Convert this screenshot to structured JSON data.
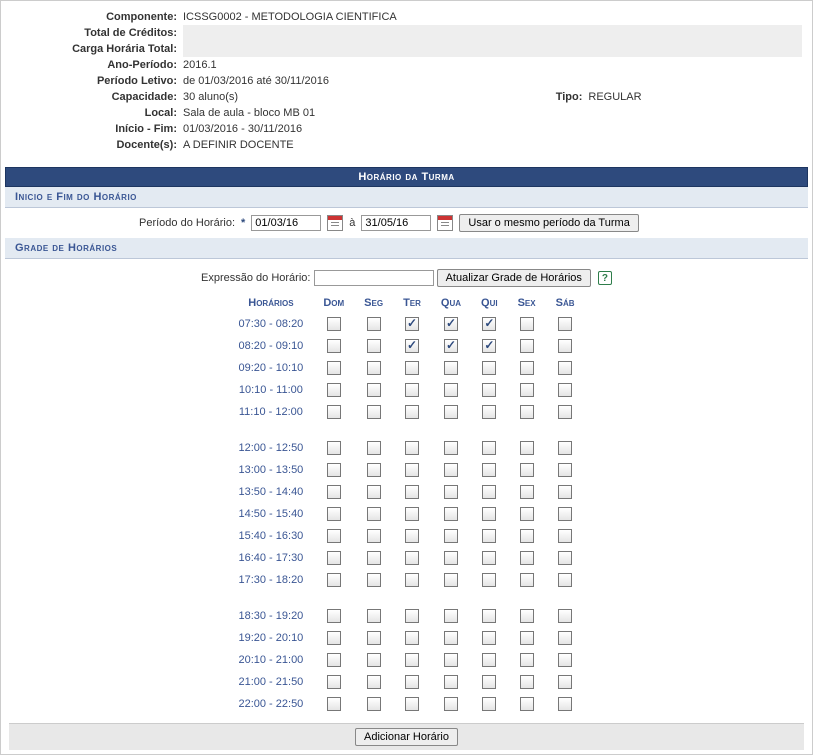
{
  "details": {
    "componente_label": "Componente:",
    "componente_value": "ICSSG0002 - METODOLOGIA CIENTIFICA",
    "creditos_label": "Total de Créditos:",
    "creditos_value": "",
    "carga_label": "Carga Horária Total:",
    "carga_value": "",
    "ano_label": "Ano-Período:",
    "ano_value": "2016.1",
    "periodo_label": "Período Letivo:",
    "periodo_value": "de 01/03/2016 até 30/11/2016",
    "capacidade_label": "Capacidade:",
    "capacidade_value": "30 aluno(s)",
    "tipo_label": "Tipo:",
    "tipo_value": "REGULAR",
    "local_label": "Local:",
    "local_value": "Sala de aula - bloco MB 01",
    "iniciofim_label": "Início - Fim:",
    "iniciofim_value": "01/03/2016 - 30/11/2016",
    "docentes_label": "Docente(s):",
    "docentes_value": "A DEFINIR DOCENTE"
  },
  "section_title": "Horário da Turma",
  "periodo_section": {
    "title": "Inicio e Fim do Horário",
    "label": "Período do Horário:",
    "start": "01/03/16",
    "sep": "à",
    "end": "31/05/16",
    "same_button": "Usar o mesmo período da Turma"
  },
  "grade_section": {
    "title": "Grade de Horários",
    "expr_label": "Expressão do Horário:",
    "expr_value": "",
    "update_button": "Atualizar Grade de Horários"
  },
  "schedule": {
    "header_time": "Horários",
    "days": [
      "Dom",
      "Seg",
      "Ter",
      "Qua",
      "Qui",
      "Sex",
      "Sáb"
    ],
    "blocks": [
      {
        "rows": [
          {
            "time": "07:30 - 08:20",
            "checks": [
              false,
              false,
              true,
              true,
              true,
              false,
              false
            ]
          },
          {
            "time": "08:20 - 09:10",
            "checks": [
              false,
              false,
              true,
              true,
              true,
              false,
              false
            ]
          },
          {
            "time": "09:20 - 10:10",
            "checks": [
              false,
              false,
              false,
              false,
              false,
              false,
              false
            ]
          },
          {
            "time": "10:10 - 11:00",
            "checks": [
              false,
              false,
              false,
              false,
              false,
              false,
              false
            ]
          },
          {
            "time": "11:10 - 12:00",
            "checks": [
              false,
              false,
              false,
              false,
              false,
              false,
              false
            ]
          }
        ]
      },
      {
        "rows": [
          {
            "time": "12:00 - 12:50",
            "checks": [
              false,
              false,
              false,
              false,
              false,
              false,
              false
            ]
          },
          {
            "time": "13:00 - 13:50",
            "checks": [
              false,
              false,
              false,
              false,
              false,
              false,
              false
            ]
          },
          {
            "time": "13:50 - 14:40",
            "checks": [
              false,
              false,
              false,
              false,
              false,
              false,
              false
            ]
          },
          {
            "time": "14:50 - 15:40",
            "checks": [
              false,
              false,
              false,
              false,
              false,
              false,
              false
            ]
          },
          {
            "time": "15:40 - 16:30",
            "checks": [
              false,
              false,
              false,
              false,
              false,
              false,
              false
            ]
          },
          {
            "time": "16:40 - 17:30",
            "checks": [
              false,
              false,
              false,
              false,
              false,
              false,
              false
            ]
          },
          {
            "time": "17:30 - 18:20",
            "checks": [
              false,
              false,
              false,
              false,
              false,
              false,
              false
            ]
          }
        ]
      },
      {
        "rows": [
          {
            "time": "18:30 - 19:20",
            "checks": [
              false,
              false,
              false,
              false,
              false,
              false,
              false
            ]
          },
          {
            "time": "19:20 - 20:10",
            "checks": [
              false,
              false,
              false,
              false,
              false,
              false,
              false
            ]
          },
          {
            "time": "20:10 - 21:00",
            "checks": [
              false,
              false,
              false,
              false,
              false,
              false,
              false
            ]
          },
          {
            "time": "21:00 - 21:50",
            "checks": [
              false,
              false,
              false,
              false,
              false,
              false,
              false
            ]
          },
          {
            "time": "22:00 - 22:50",
            "checks": [
              false,
              false,
              false,
              false,
              false,
              false,
              false
            ]
          }
        ]
      }
    ]
  },
  "add_button": "Adicionar Horário"
}
